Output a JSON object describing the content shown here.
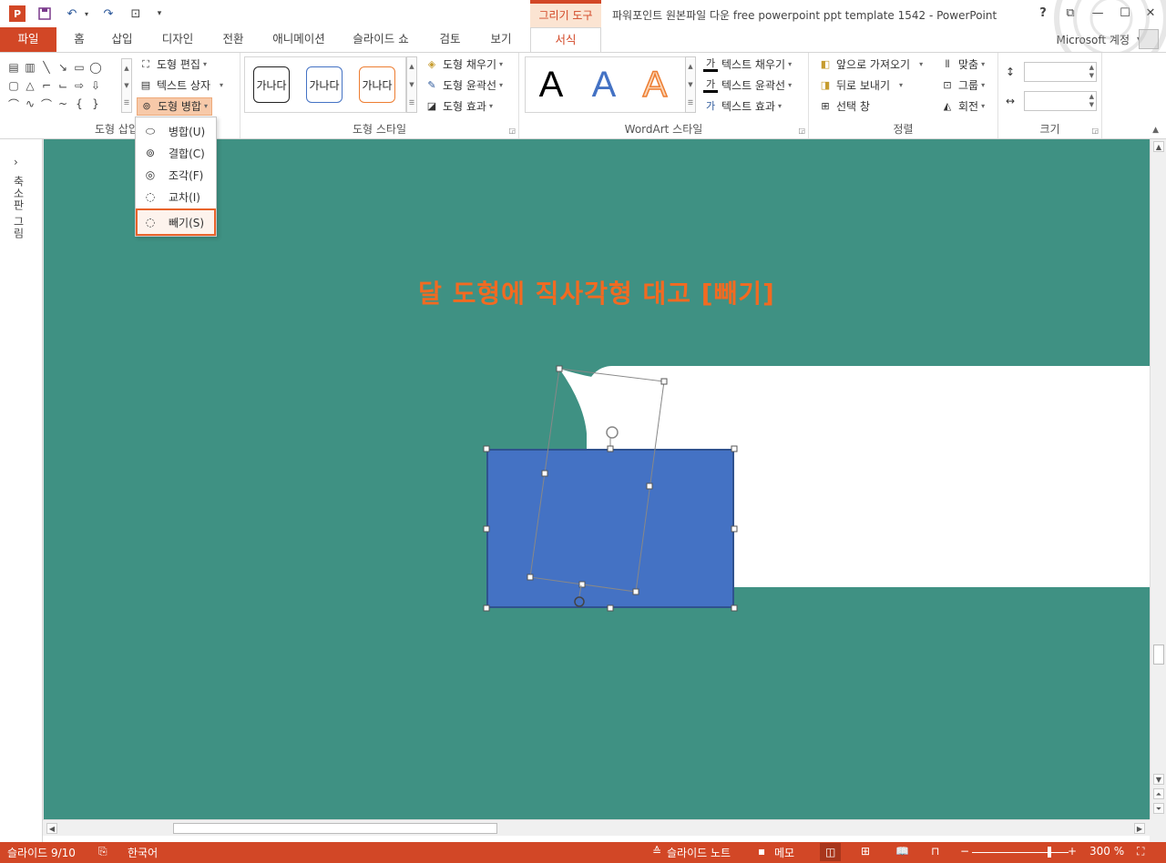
{
  "title_bar": {
    "context_group": "그리기 도구",
    "window_title": "파워포인트 원본파일 다운 free powerpoint ppt template 1542 - PowerPoint",
    "help": "?",
    "account": "Microsoft 계정"
  },
  "tabs": [
    {
      "label": "파일"
    },
    {
      "label": "홈"
    },
    {
      "label": "삽입"
    },
    {
      "label": "디자인"
    },
    {
      "label": "전환"
    },
    {
      "label": "애니메이션"
    },
    {
      "label": "슬라이드 쇼"
    },
    {
      "label": "검토"
    },
    {
      "label": "보기"
    },
    {
      "label": "서식"
    }
  ],
  "ribbon": {
    "insert_shapes": {
      "label": "도형 삽입",
      "edit_shape": "도형 편집",
      "text_box": "텍스트 상자",
      "merge_shapes": "도형 병합"
    },
    "shape_styles": {
      "label": "도형 스타일",
      "preset_text": "가나다",
      "fill": "도형 채우기",
      "outline": "도형 윤곽선",
      "effects": "도형 효과"
    },
    "wordart": {
      "label": "WordArt 스타일",
      "letter": "A",
      "text_fill": "텍스트 채우기",
      "text_outline": "텍스트 윤곽선",
      "text_effects": "텍스트 효과"
    },
    "arrange": {
      "label": "정렬",
      "bring_forward": "앞으로 가져오기",
      "send_backward": "뒤로 보내기",
      "selection_pane": "선택 창",
      "align": "맞춤",
      "group": "그룹",
      "rotate": "회전"
    },
    "size": {
      "label": "크기"
    }
  },
  "merge_menu": [
    {
      "label": "병합(U)"
    },
    {
      "label": "결합(C)"
    },
    {
      "label": "조각(F)"
    },
    {
      "label": "교차(I)"
    },
    {
      "label": "빼기(S)"
    }
  ],
  "thumb_pane": {
    "label": "축소판 그림"
  },
  "slide": {
    "caption": "달 도형에 직사각형 대고 [빼기]"
  },
  "status": {
    "slide_counter": "슬라이드 9/10",
    "language": "한국어",
    "notes": "슬라이드 노트",
    "comments": "메모",
    "zoom": "300 %"
  },
  "colors": {
    "accent": "#d24726",
    "slide_bg": "#3f9183",
    "selected_shape": "#4472c4",
    "caption": "#f26a21"
  }
}
